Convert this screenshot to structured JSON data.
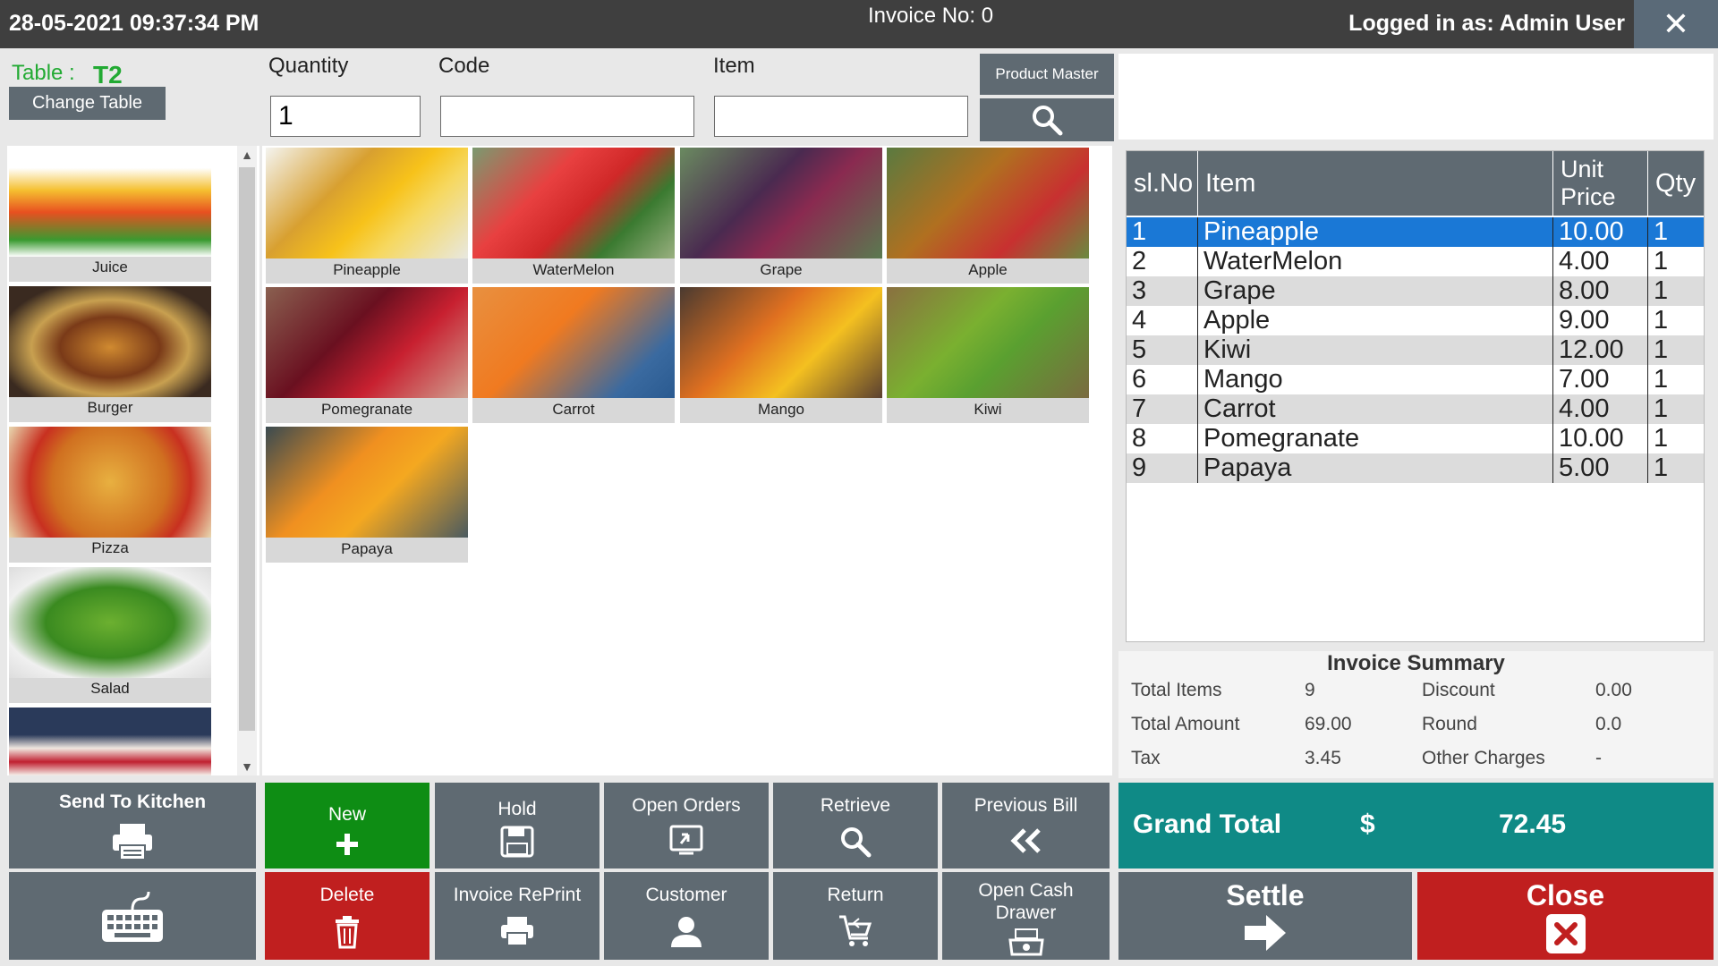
{
  "titlebar": {
    "datetime": "28-05-2021 09:37:34 PM",
    "invoice": "Invoice No: 0",
    "user": "Logged in as: Admin User",
    "close_glyph": "✕"
  },
  "table": {
    "label": "Table :",
    "value": "T2",
    "change_label": "Change Table"
  },
  "fields": {
    "quantity_label": "Quantity",
    "quantity_value": "1",
    "code_label": "Code",
    "code_value": "",
    "item_label": "Item",
    "item_value": ""
  },
  "product_master_label": "Product Master",
  "categories": [
    {
      "label": "Juice"
    },
    {
      "label": "Burger"
    },
    {
      "label": "Pizza"
    },
    {
      "label": "Salad"
    },
    {
      "label": ""
    }
  ],
  "products": [
    {
      "label": "Pineapple"
    },
    {
      "label": "WaterMelon"
    },
    {
      "label": "Grape"
    },
    {
      "label": "Apple"
    },
    {
      "label": "Pomegranate"
    },
    {
      "label": "Carrot"
    },
    {
      "label": "Mango"
    },
    {
      "label": "Kiwi"
    },
    {
      "label": "Papaya"
    }
  ],
  "grid": {
    "headers": [
      "sl.No",
      "Item",
      "Unit Price",
      "Qty"
    ],
    "rows": [
      {
        "sl": "1",
        "item": "Pineapple",
        "price": "10.00",
        "qty": "1"
      },
      {
        "sl": "2",
        "item": "WaterMelon",
        "price": "4.00",
        "qty": "1"
      },
      {
        "sl": "3",
        "item": "Grape",
        "price": "8.00",
        "qty": "1"
      },
      {
        "sl": "4",
        "item": "Apple",
        "price": "9.00",
        "qty": "1"
      },
      {
        "sl": "5",
        "item": "Kiwi",
        "price": "12.00",
        "qty": "1"
      },
      {
        "sl": "6",
        "item": "Mango",
        "price": "7.00",
        "qty": "1"
      },
      {
        "sl": "7",
        "item": "Carrot",
        "price": "4.00",
        "qty": "1"
      },
      {
        "sl": "8",
        "item": "Pomegranate",
        "price": "10.00",
        "qty": "1"
      },
      {
        "sl": "9",
        "item": "Papaya",
        "price": "5.00",
        "qty": "1"
      }
    ]
  },
  "summary": {
    "title": "Invoice Summary",
    "total_items_label": "Total Items",
    "total_items": "9",
    "total_amount_label": "Total Amount",
    "total_amount": "69.00",
    "tax_label": "Tax",
    "tax": "3.45",
    "discount_label": "Discount",
    "discount": "0.00",
    "round_label": "Round",
    "round": "0.0",
    "other_label": "Other Charges",
    "other": "-"
  },
  "grand_total": {
    "label": "Grand Total",
    "currency": "$",
    "value": "72.45"
  },
  "buttons": {
    "send_kitchen": "Send To Kitchen",
    "new": "New",
    "hold": "Hold",
    "open_orders": "Open Orders",
    "retrieve": "Retrieve",
    "previous_bill": "Previous Bill",
    "delete": "Delete",
    "invoice_reprint": "Invoice RePrint",
    "customer": "Customer",
    "return": "Return",
    "open_cash_drawer": "Open Cash Drawer",
    "settle": "Settle",
    "close": "Close"
  },
  "colors": {
    "accent_green": "#0e8d14",
    "accent_red": "#c01f1f",
    "accent_teal": "#0f8a86",
    "selection_blue": "#1a78d6"
  }
}
